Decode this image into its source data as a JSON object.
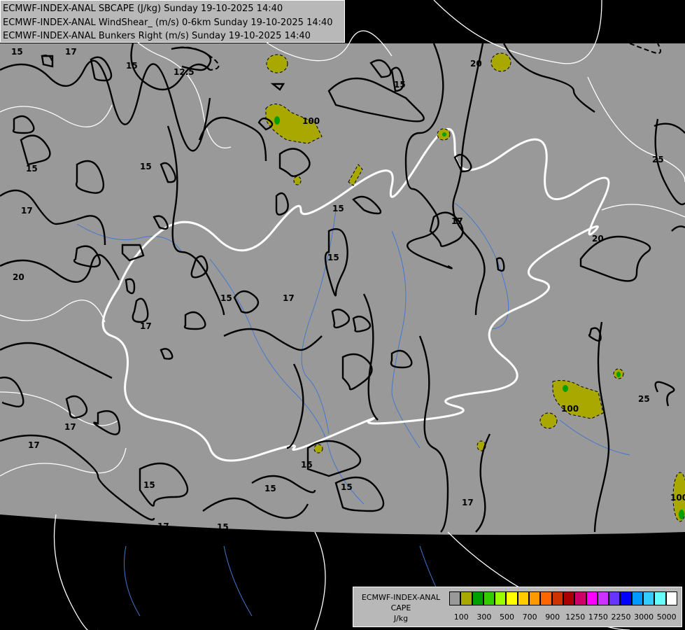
{
  "titles": [
    "ECMWF-INDEX-ANAL SBCAPE (J/kg) Sunday 19-10-2025 14:40",
    "ECMWF-INDEX-ANAL WindShear_ (m/s) 0-6km Sunday 19-10-2025 14:40",
    "ECMWF-INDEX-ANAL Bunkers Right (m/s) Sunday 19-10-2025 14:40"
  ],
  "legend": {
    "name_lines": [
      "ECMWF-INDEX-ANAL",
      "CAPE",
      "J/kg"
    ],
    "colors": [
      "#999999",
      "#a8a800",
      "#00a000",
      "#33cc00",
      "#99ff00",
      "#ffff00",
      "#ffcc00",
      "#ff9900",
      "#ff6600",
      "#cc3300",
      "#aa0000",
      "#cc0066",
      "#ff00ff",
      "#cc33ff",
      "#6633ff",
      "#0000ff",
      "#0099ff",
      "#33ccff",
      "#66ffff",
      "#ffffff"
    ],
    "tick_labels": [
      "100",
      "300",
      "500",
      "700",
      "900",
      "1250",
      "1750",
      "2250",
      "3000",
      "5000"
    ]
  },
  "contour_labels": [
    "12.5",
    "15",
    "17",
    "20",
    "25",
    "100"
  ],
  "colors": {
    "background": "#000000",
    "domain": "#999999",
    "contour": "#000000",
    "cape_low": "#a8a800",
    "cape_mid": "#00a000",
    "border": "#ffffff",
    "river": "#4477cc"
  }
}
